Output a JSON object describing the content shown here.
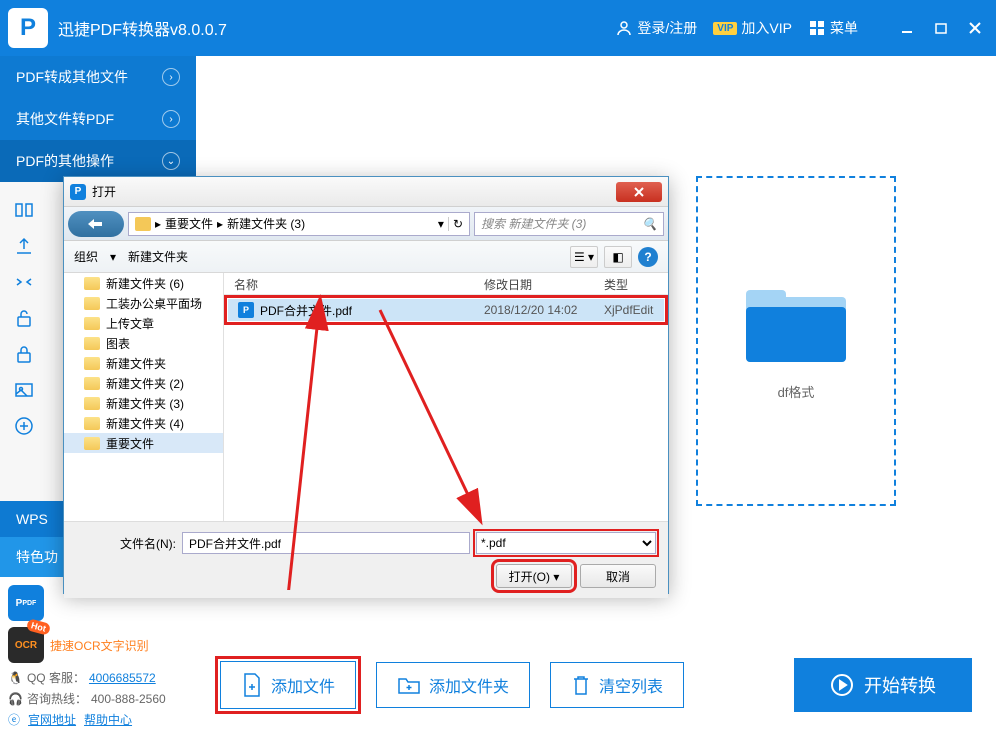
{
  "titlebar": {
    "app_name": "迅捷PDF转换器v8.0.0.7",
    "login": "登录/注册",
    "vip": "加入VIP",
    "menu": "菜单"
  },
  "sidebar": {
    "nav": [
      {
        "label": "PDF转成其他文件",
        "expanded": false
      },
      {
        "label": "其他文件转PDF",
        "expanded": false
      },
      {
        "label": "PDF的其他操作",
        "expanded": true
      }
    ],
    "wps": "WPS",
    "special": "特色功",
    "ocr_promo": "捷速OCR文字识别",
    "qq_label": "QQ 客服：",
    "qq_number": "4006685572",
    "hotline_label": "咨询热线：",
    "hotline_number": "400-888-2560",
    "official_site": "官网地址",
    "help_center": "帮助中心"
  },
  "content": {
    "format_hint": "df格式"
  },
  "actions": {
    "add_file": "添加文件",
    "add_folder": "添加文件夹",
    "clear_list": "清空列表",
    "start_convert": "开始转换"
  },
  "dialog": {
    "title": "打开",
    "breadcrumb": [
      "重要文件",
      "新建文件夹 (3)"
    ],
    "search_placeholder": "搜索 新建文件夹 (3)",
    "organize": "组织",
    "new_folder": "新建文件夹",
    "tree_items": [
      "新建文件夹 (6)",
      "工装办公桌平面场",
      "上传文章",
      "图表",
      "新建文件夹",
      "新建文件夹 (2)",
      "新建文件夹 (3)",
      "新建文件夹 (4)",
      "重要文件"
    ],
    "tree_selected": "重要文件",
    "columns": {
      "name": "名称",
      "date": "修改日期",
      "type": "类型"
    },
    "files": [
      {
        "name": "PDF合并文件.pdf",
        "date": "2018/12/20 14:02",
        "type": "XjPdfEdit"
      }
    ],
    "filename_label": "文件名(N):",
    "filename_value": "PDF合并文件.pdf",
    "filter": "*.pdf",
    "open_btn": "打开(O)",
    "cancel_btn": "取消"
  }
}
